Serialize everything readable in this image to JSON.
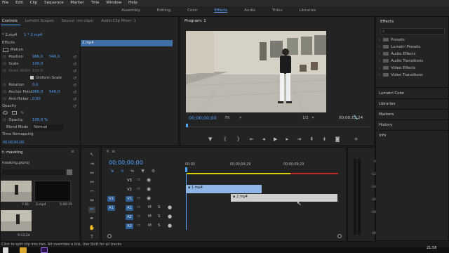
{
  "menu": [
    "File",
    "Edit",
    "Clip",
    "Sequence",
    "Marker",
    "Title",
    "Window",
    "Help"
  ],
  "workspaces": [
    "Assembly",
    "Editing",
    "Color",
    "Effects",
    "Audio",
    "Titles",
    "Libraries"
  ],
  "workspace_active": "Effects",
  "left_tabs": [
    "Controls",
    "Lumetri Scopes",
    "Source: (no clips)",
    "Audio Clip Mixer: 1"
  ],
  "left_tab_active": "Controls",
  "controls_sub": "* 2.mp4",
  "controls_sub_active": "1 * 2.mp4",
  "clip_chip": "2.mp4",
  "effects_rows": {
    "heading": "Effects",
    "motion": "Motion",
    "position_label": "Position",
    "position_x": "960,0",
    "position_y": "540,0",
    "scale_label": "Scale",
    "scale_val": "100,0",
    "scale_width_label": "Scale Width",
    "scale_width_val": "100,0",
    "uniform_scale": "Uniform Scale",
    "rotation_label": "Rotation",
    "rotation_val": "0,0",
    "anchor_label": "Anchor Point",
    "anchor_x": "960,0",
    "anchor_y": "540,0",
    "antiflicker_label": "Anti-flicker ...",
    "antiflicker_val": "0,00",
    "opacity_heading": "Opacity",
    "opacity_label": "Opacity",
    "opacity_val": "100,0 %",
    "blend_label": "Blend Mode",
    "blend_val": "Normal",
    "time_remapping": "Time Remapping"
  },
  "controls_timecode": "00;00;00;00",
  "program": {
    "title": "Program: 1",
    "timecode": "00;00;00;00",
    "fit": "Fit",
    "res": "1/2",
    "duration": "00;00;13;24"
  },
  "project": {
    "title": "t: masking",
    "file": "masking.prproj",
    "thumbs": [
      {
        "name": "",
        "dur": "7:01"
      },
      {
        "name": "2.mp4",
        "dur": "5:00:15"
      },
      {
        "name": "",
        "dur": "5:13;24"
      }
    ]
  },
  "timeline": {
    "timecode": "00;00;00;00",
    "ruler": [
      "00;00",
      "00;00;04;29",
      "00;00;09;29"
    ],
    "tracks": [
      "V3",
      "V2",
      "V1",
      "A1",
      "A2",
      "A3"
    ],
    "targets": [
      "V1",
      "A1"
    ],
    "clip1": "1.mp4",
    "clip2": "2.mp4"
  },
  "meter_ticks": [
    "0",
    "-12",
    "-24",
    "-36",
    "-48",
    "dB"
  ],
  "right_panel": {
    "title": "Effects",
    "folders": [
      "Presets",
      "Lumetri Presets",
      "Audio Effects",
      "Audio Transitions",
      "Video Effects",
      "Video Transitions"
    ],
    "sections": [
      "Lumetri Color",
      "Libraries",
      "Markers",
      "History",
      "Info"
    ]
  },
  "status": "Click to split clip into two. Alt overrides a link. Use Shift for all tracks.",
  "clock": "21:58",
  "colors": {
    "accent": "#4fa3ff",
    "clip_video": "#8fb6e6",
    "clip_selected": "#cfcfcf",
    "work_area": "#d9d000",
    "render_red": "#c42727"
  }
}
